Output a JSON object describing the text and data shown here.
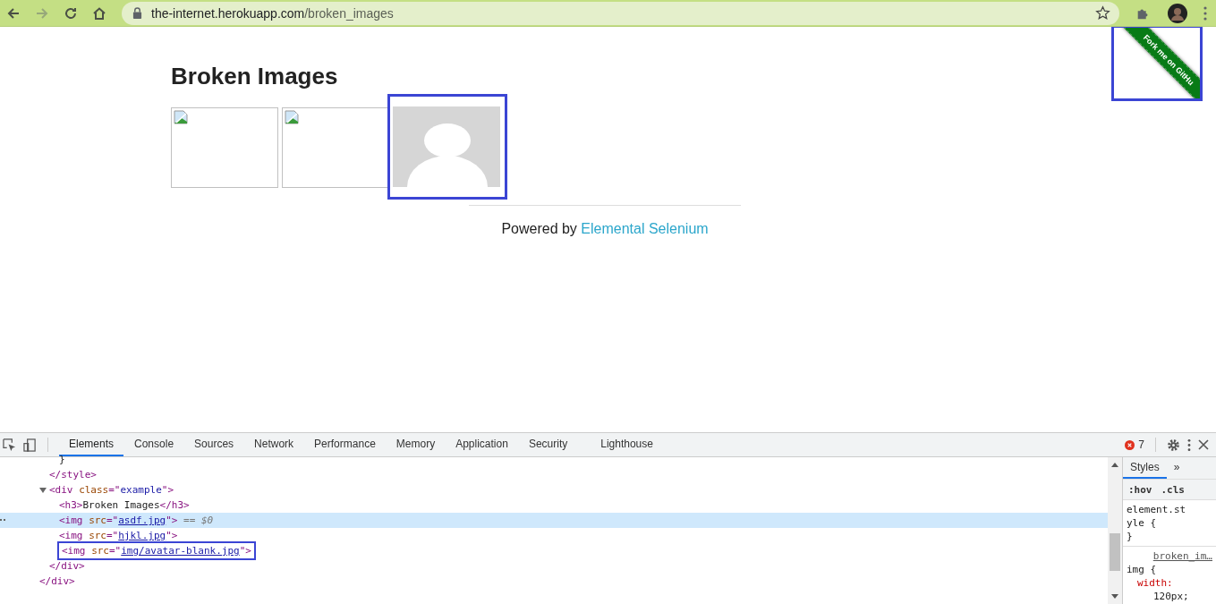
{
  "browser": {
    "url_host": "the-internet.herokuapp.com",
    "url_path": "/broken_images",
    "forward_disabled": true
  },
  "page": {
    "heading": "Broken Images",
    "images": [
      {
        "kind": "broken",
        "highlighted": false
      },
      {
        "kind": "broken",
        "highlighted": false
      },
      {
        "kind": "avatar",
        "highlighted": true
      }
    ],
    "footer": {
      "text": "Powered by",
      "link": "Elemental Selenium"
    },
    "ribbon": {
      "text": "Fork me on GitHu",
      "highlighted": true
    }
  },
  "devtools": {
    "tabs": [
      {
        "label": "Elements",
        "selected": true
      },
      {
        "label": "Console",
        "selected": false
      },
      {
        "label": "Sources",
        "selected": false
      },
      {
        "label": "Network",
        "selected": false
      },
      {
        "label": "Performance",
        "selected": false
      },
      {
        "label": "Memory",
        "selected": false
      },
      {
        "label": "Application",
        "selected": false
      },
      {
        "label": "Security",
        "selected": false
      },
      {
        "label": "Lighthouse",
        "selected": false
      }
    ],
    "error_count": "7",
    "dom": [
      {
        "closing": [
          {
            "kind": "tag",
            "text": "</div>"
          }
        ],
        "children": [
          {
            "closing": [
              {
                "kind": "tag",
                "text": "</style>"
              }
            ],
            "children": [
              {
                "parts": [
                  {
                    "kind": "text",
                    "text": "}"
                  }
                ]
              }
            ]
          },
          {
            "expanded": true,
            "parts": [
              {
                "kind": "tag",
                "text": "<div "
              },
              {
                "kind": "attr",
                "text": "class"
              },
              {
                "kind": "tag",
                "text": "=\""
              },
              {
                "kind": "value",
                "text": "example"
              },
              {
                "kind": "tag",
                "text": "\">"
              }
            ],
            "closing": [
              {
                "kind": "tag",
                "text": "</div>"
              }
            ],
            "children": [
              {
                "parts": [
                  {
                    "kind": "tag",
                    "text": "<h3>"
                  },
                  {
                    "kind": "text",
                    "text": "Broken Images"
                  },
                  {
                    "kind": "tag",
                    "text": "</h3>"
                  }
                ]
              },
              {
                "selected": true,
                "parts": [
                  {
                    "kind": "tag",
                    "text": "<img "
                  },
                  {
                    "kind": "attr",
                    "text": "src"
                  },
                  {
                    "kind": "tag",
                    "text": "=\""
                  },
                  {
                    "kind": "link",
                    "text": "asdf.jpg"
                  },
                  {
                    "kind": "tag",
                    "text": "\">"
                  },
                  {
                    "kind": "hint",
                    "text": " == $0"
                  }
                ]
              },
              {
                "parts": [
                  {
                    "kind": "tag",
                    "text": "<img "
                  },
                  {
                    "kind": "attr",
                    "text": "src"
                  },
                  {
                    "kind": "tag",
                    "text": "=\""
                  },
                  {
                    "kind": "link",
                    "text": "hjkl.jpg"
                  },
                  {
                    "kind": "tag",
                    "text": "\">"
                  }
                ]
              },
              {
                "highlighted": true,
                "parts": [
                  {
                    "kind": "tag",
                    "text": "<img "
                  },
                  {
                    "kind": "attr",
                    "text": "src"
                  },
                  {
                    "kind": "tag",
                    "text": "=\""
                  },
                  {
                    "kind": "link",
                    "text": "img/avatar-blank.jpg"
                  },
                  {
                    "kind": "tag",
                    "text": "\">"
                  }
                ]
              }
            ]
          }
        ]
      }
    ],
    "styles": {
      "tabs": [
        {
          "label": "Styles",
          "selected": true
        },
        {
          "label": "»",
          "selected": false
        }
      ],
      "filters": [
        ":hov",
        ".cls"
      ],
      "element_rule": {
        "selector": "element.style {",
        "close": "}"
      },
      "rule": {
        "source": "broken_im…",
        "selector": "img {",
        "property": "width:",
        "value": "120px;"
      }
    }
  }
}
